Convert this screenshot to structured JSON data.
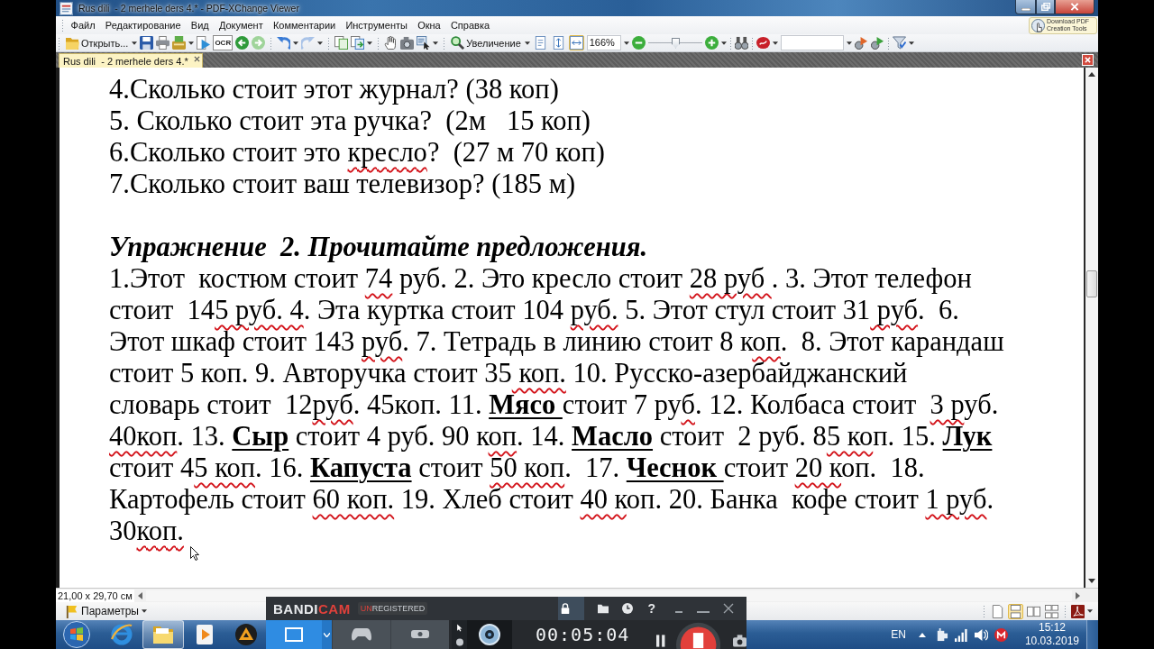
{
  "window": {
    "title": "Rus dili  - 2 merhele ders 4.* - PDF-XChange Viewer"
  },
  "menu": [
    "Файл",
    "Редактирование",
    "Вид",
    "Документ",
    "Комментарии",
    "Инструменты",
    "Окна",
    "Справка"
  ],
  "promo_button": "Download PDF Creation Tools",
  "toolbar": {
    "open_label": "Открыть...",
    "ocr_label": "OCR",
    "zoom_tool_label": "Увеличение",
    "fit_buttons": [
      {
        "selected": false
      },
      {
        "selected": false
      },
      {
        "selected": true
      }
    ],
    "zoom_value": "166%",
    "zoom_slider": {
      "level": 0.52
    }
  },
  "tabs": [
    {
      "label": "Rus dili  - 2 merhele ders 4.*",
      "selected": true
    }
  ],
  "document": {
    "lines": [
      {
        "segments": [
          {
            "kind": "plain",
            "text": "4.Сколько стоит этот журнал? (38 коп)"
          }
        ]
      },
      {
        "segments": [
          {
            "kind": "plain",
            "text": "5. Сколько стоит эта ручка?  (2м   15 коп)"
          }
        ]
      },
      {
        "segments": [
          {
            "kind": "plain",
            "text": "6.Сколько стоит это "
          },
          {
            "kind": "pen",
            "text": "кресло"
          },
          {
            "kind": "plain",
            "text": "?  (27 м 70 коп)"
          }
        ]
      },
      {
        "segments": [
          {
            "kind": "plain",
            "text": "7.Сколько стоит ваш телевизор? (185 м)"
          }
        ]
      }
    ],
    "heading": "Упражнение  2. Прочитайте предложения.",
    "paragraph": [
      {
        "kind": "plain",
        "text": "1.Этот  костюм стоит "
      },
      {
        "kind": "pen",
        "text": "74"
      },
      {
        "kind": "plain",
        "text": " руб. 2. Это кресло стоит "
      },
      {
        "kind": "pen",
        "text": "28 руб "
      },
      {
        "kind": "plain",
        "text": ". 3. Этот телефон\nстоит  14"
      },
      {
        "kind": "pen",
        "text": "5 руб. 4"
      },
      {
        "kind": "plain",
        "text": ". Эта куртка стоит 104 "
      },
      {
        "kind": "pen",
        "text": "руб."
      },
      {
        "kind": "plain",
        "text": " 5. Этот стул стоит 31"
      },
      {
        "kind": "pen",
        "text": " руб"
      },
      {
        "kind": "plain",
        "text": ".  6.\nЭтот шкаф стоит 143 "
      },
      {
        "kind": "pen",
        "text": "руб"
      },
      {
        "kind": "plain",
        "text": ". 7. Тетрадь в линию стоит 8 к"
      },
      {
        "kind": "pen",
        "text": "оп"
      },
      {
        "kind": "plain",
        "text": ".  8. Этот карандаш\nстоит 5 коп. 9. Авторучка стоит 35"
      },
      {
        "kind": "pen",
        "text": " коп."
      },
      {
        "kind": "plain",
        "text": " 10. Русско-азербайджанский\nсловарь стоит  12"
      },
      {
        "kind": "pen",
        "text": "руб"
      },
      {
        "kind": "plain",
        "text": ". 45коп. 11. "
      },
      {
        "kind": "keyword",
        "text": "Мясо "
      },
      {
        "kind": "plain",
        "text": "стоит 7 ру"
      },
      {
        "kind": "pen",
        "text": "б"
      },
      {
        "kind": "plain",
        "text": ". 12. Колбаса стоит  "
      },
      {
        "kind": "pen",
        "text": "3 р"
      },
      {
        "kind": "plain",
        "text": "уб.\n"
      },
      {
        "kind": "pen",
        "text": "40коп"
      },
      {
        "kind": "plain",
        "text": ". 13. "
      },
      {
        "kind": "keyword",
        "text": "Сыр"
      },
      {
        "kind": "plain",
        "text": " стоит 4 руб. 90 к"
      },
      {
        "kind": "pen",
        "text": "оп"
      },
      {
        "kind": "plain",
        "text": ". 14. "
      },
      {
        "kind": "keyword",
        "text": "Масло"
      },
      {
        "kind": "plain",
        "text": " стоит  2 руб. 8"
      },
      {
        "kind": "pen",
        "text": "5 ко"
      },
      {
        "kind": "plain",
        "text": "п. 15. "
      },
      {
        "kind": "keyword",
        "text": "Лук"
      },
      {
        "kind": "plain",
        "text": "\nстоит 4"
      },
      {
        "kind": "pen",
        "text": "5 коп"
      },
      {
        "kind": "plain",
        "text": ". 16. "
      },
      {
        "kind": "keyword",
        "text": "Капуста"
      },
      {
        "kind": "plain",
        "text": " стоит "
      },
      {
        "kind": "pen",
        "text": "50 коп"
      },
      {
        "kind": "plain",
        "text": ".  17. "
      },
      {
        "kind": "keyword",
        "text": "Чеснок "
      },
      {
        "kind": "plain",
        "text": "стоит "
      },
      {
        "kind": "pen",
        "text": "20 к"
      },
      {
        "kind": "plain",
        "text": "оп.  18.\nКартофель стоит "
      },
      {
        "kind": "pen",
        "text": "60 коп."
      },
      {
        "kind": "plain",
        "text": " 19. Хлеб стоит "
      },
      {
        "kind": "pen",
        "text": "40 к"
      },
      {
        "kind": "plain",
        "text": "оп. 20. Банка  кофе стоит "
      },
      {
        "kind": "pen",
        "text": "1 руб"
      },
      {
        "kind": "plain",
        "text": ".\n30"
      },
      {
        "kind": "pen",
        "text": "коп."
      }
    ]
  },
  "status_bar": {
    "page_size": "21,00 x 29,70 см",
    "options_label": "Параметры",
    "layout_buttons": [
      {
        "selected": false
      },
      {
        "selected": true
      },
      {
        "selected": false
      },
      {
        "selected": false
      }
    ]
  },
  "bandicam": {
    "logo": [
      "BANDI",
      "CAM"
    ],
    "badge": [
      "UN",
      "REGISTERED"
    ],
    "help": "?",
    "timer": "00:05:04"
  },
  "taskbar": {
    "apps": [
      {
        "selected": false
      },
      {
        "selected": true
      },
      {
        "selected": false
      },
      {
        "selected": false
      }
    ],
    "language": "EN",
    "time": "15:12",
    "date": "10.03.2019"
  }
}
